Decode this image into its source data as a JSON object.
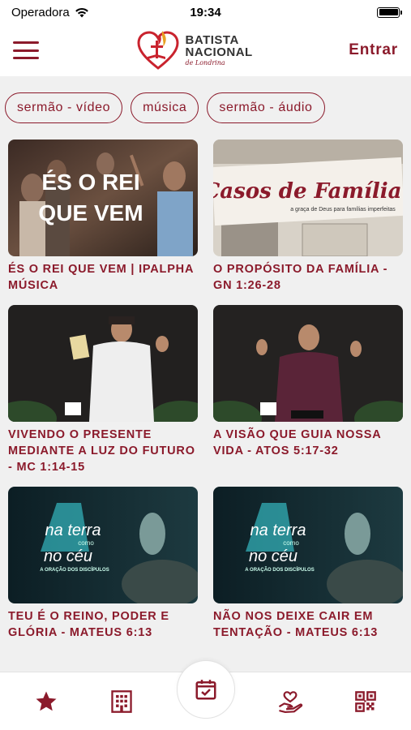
{
  "status_bar": {
    "carrier": "Operadora",
    "time": "19:34"
  },
  "header": {
    "logo_line1": "BATISTA",
    "logo_line2": "NACIONAL",
    "logo_subtitle": "de Londrina",
    "login_label": "Entrar"
  },
  "chips": [
    {
      "label": "sermão - vídeo"
    },
    {
      "label": "música"
    },
    {
      "label": "sermão - áudio"
    }
  ],
  "thumbnails": {
    "card0_text1": "ÉS O REI",
    "card0_text2": "QUE VEM",
    "card1_text1": "Casos de Família",
    "card1_text2": "a graça de Deus para famílias imperfeitas",
    "card4_text1": "na terra",
    "card4_text2": "como",
    "card4_text3": "no céu",
    "card4_text4": "A ORAÇÃO DOS DISCÍPULOS",
    "card5_text1": "na terra",
    "card5_text2": "como",
    "card5_text3": "no céu",
    "card5_text4": "A ORAÇÃO DOS DISCÍPULOS"
  },
  "cards": [
    {
      "title": "ÉS O REI QUE VEM | IPALPHA MÚSICA"
    },
    {
      "title": "O PROPÓSITO DA FAMÍLIA - GN 1:26-28"
    },
    {
      "title": "VIVENDO O PRESENTE MEDIANTE A LUZ DO FUTURO - MC 1:14-15"
    },
    {
      "title": "A VISÃO QUE GUIA NOSSA VIDA - ATOS 5:17-32"
    },
    {
      "title": "TEU É O REINO, PODER E GLÓRIA - MATEUS 6:13"
    },
    {
      "title": "NÃO NOS DEIXE CAIR EM TENTAÇÃO - MATEUS 6:13"
    }
  ],
  "bottom_nav": {
    "items": [
      {
        "icon": "star-icon"
      },
      {
        "icon": "building-icon"
      },
      {
        "icon": "calendar-check-icon"
      },
      {
        "icon": "heart-hand-icon"
      },
      {
        "icon": "qr-code-icon"
      }
    ]
  },
  "colors": {
    "brand": "#8b1a2b",
    "background": "#f0f0f0"
  }
}
